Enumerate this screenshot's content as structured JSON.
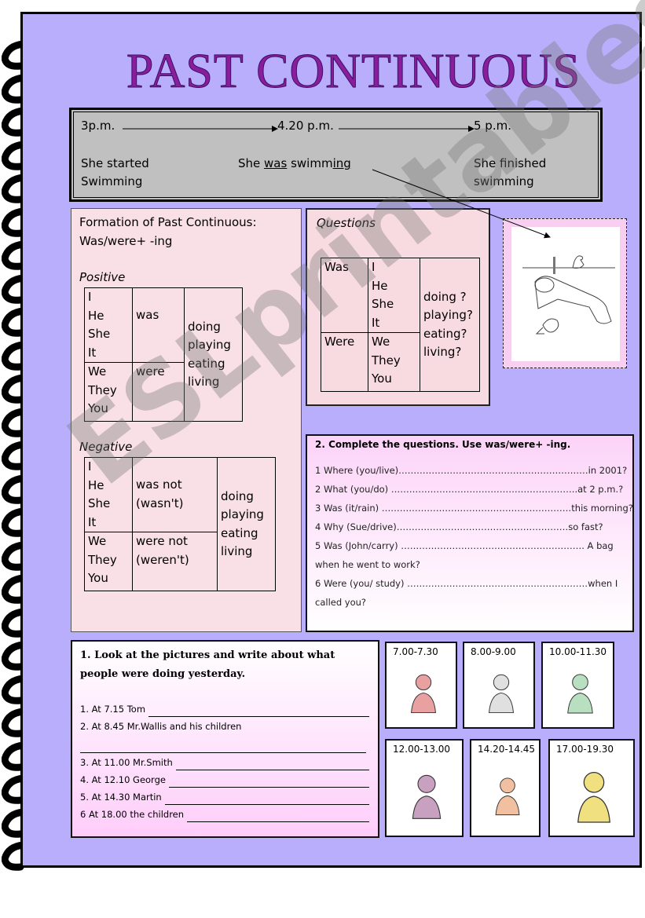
{
  "title": "PAST CONTINUOUS",
  "timeline": {
    "times": [
      "3p.m.",
      "4.20 p.m.",
      "5 p.m."
    ],
    "events": [
      {
        "line1": "She started",
        "line2": "Swimming"
      },
      {
        "prefix": "She ",
        "underlined1": "was",
        "middle": " swimm",
        "underlined2": "ing"
      },
      {
        "line1": "She finished",
        "line2": "swimming"
      }
    ]
  },
  "formation": {
    "heading": "Formation of Past Continuous:",
    "rule": "Was/were+ -ing",
    "positive": {
      "label": "Positive",
      "pronouns_singular": [
        "I",
        "He",
        "She",
        "It"
      ],
      "pronouns_plural": [
        "We",
        "They",
        "You"
      ],
      "aux_singular": "was",
      "aux_plural": "were",
      "verbs": [
        "doing",
        "playing",
        "eating",
        "living"
      ]
    },
    "negative": {
      "label": "Negative",
      "pronouns_singular": [
        "I",
        "He",
        "She",
        "It"
      ],
      "pronouns_plural": [
        "We",
        "They",
        "You"
      ],
      "aux_singular": [
        "was not",
        "(wasn't)"
      ],
      "aux_plural": [
        "were  not",
        "(weren't)"
      ],
      "verbs": [
        "doing",
        "playing",
        "eating",
        "living"
      ]
    }
  },
  "questions": {
    "label": "Questions",
    "aux_singular": "Was",
    "aux_plural": "Were",
    "pronouns_singular": [
      "I",
      "He",
      "She",
      "It"
    ],
    "pronouns_plural": [
      "We",
      "They",
      "You"
    ],
    "verbs": [
      "doing ?",
      "playing?",
      "eating?",
      "living?"
    ]
  },
  "exercise2": {
    "title": "2. Complete the questions. Use was/were+ -ing.",
    "lines": [
      "1 Where (you/live)………………………………………………………in 2001?",
      "2 What (you/do) ……………………………………………………..at 2 p.m.?",
      "3 Was (it/rain) ………………………………………………………this morning?",
      "4 Why (Sue/drive)…………………………………………………so fast?",
      "5 Was (John/carry) ……………………………………………………. A bag",
      "when he went to work?",
      "6 Were (you/ study) ……………………………………………………when I",
      "called you?"
    ]
  },
  "exercise1": {
    "title": "1. Look at the pictures and write about what people were doing yesterday.",
    "items": [
      "1. At 7.15 Tom",
      "2. At 8.45 Mr.Wallis and his children",
      "",
      "3. At 11.00 Mr.Smith",
      "4. At 12.10 George",
      "5. At 14.30 Martin",
      "6 At 18.00 the children"
    ]
  },
  "pictures": [
    {
      "time": "7.00-7.30",
      "icon": "eating-sandwich-icon"
    },
    {
      "time": "8.00-9.00",
      "icon": "reading-to-children-icon"
    },
    {
      "time": "10.00-11.30",
      "icon": "playing-tennis-icon"
    },
    {
      "time": "12.00-13.00",
      "icon": "cooking-icon"
    },
    {
      "time": "14.20-14.45",
      "icon": "ironing-icon"
    },
    {
      "time": "17.00-19.30",
      "icon": "watching-tv-icon"
    }
  ],
  "watermark": "ESLprintables.com",
  "colors": {
    "page": "#b8aefc",
    "title": "#8a1c9e",
    "timeline_bg": "#c0c0c0",
    "formation_bg": "#f8e0e6",
    "exercise_pink": "#fecdfa"
  }
}
